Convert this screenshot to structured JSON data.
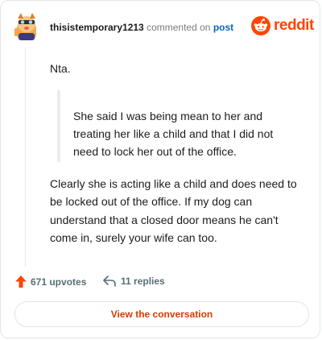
{
  "header": {
    "username": "thisistemporary1213",
    "commented_text": "commented on",
    "post_link": "post",
    "brand": "reddit"
  },
  "comment": {
    "opening": "Nta.",
    "quote": "She said I was being mean to her and treating her like a child and that I did not need to lock her out of the office.",
    "body": "Clearly she is acting like a child and does need to be locked out of the office. If my dog can understand that a closed door means he can't come in, surely your wife can too."
  },
  "footer": {
    "upvotes": "671 upvotes",
    "replies": "11 replies",
    "view_button": "View the conversation"
  },
  "colors": {
    "accent": "#ff4500",
    "link": "#0a66c2",
    "meta": "#576f76",
    "button_text": "#d93a00"
  },
  "icons": {
    "avatar": "cartoon-avatar-icon",
    "logo": "reddit-snoo-icon",
    "upvote": "upvote-arrow-icon",
    "reply": "reply-arrow-icon"
  }
}
